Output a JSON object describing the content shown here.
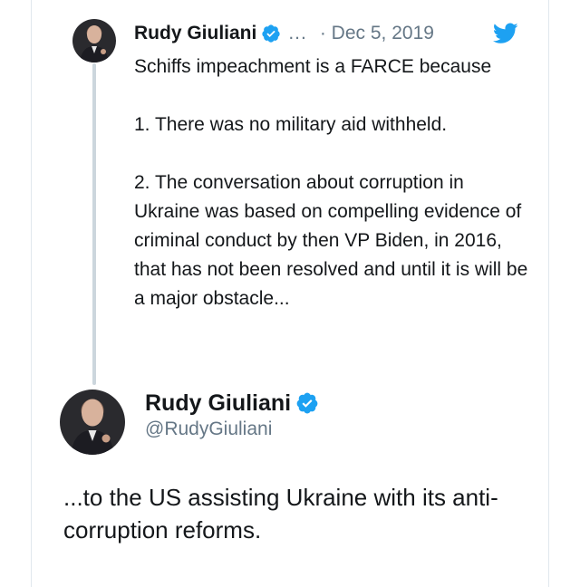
{
  "reply": {
    "author_name": "Rudy Giuliani",
    "more": "...",
    "date": "· Dec 5, 2019",
    "lines": [
      "Schiffs impeachment is a FARCE because",
      "",
      "1. There was no military aid withheld.",
      "",
      "2. The conversation about corruption in Ukraine was based on compelling evidence of criminal conduct by then VP Biden, in 2016, that has not been resolved and until it is will be a major obstacle..."
    ]
  },
  "tweet": {
    "author_name": "Rudy Giuliani",
    "handle": "@RudyGiuliani",
    "text": "...to the US assisting Ukraine with its anti-corruption reforms."
  },
  "icons": {
    "verified": "verified-badge-icon",
    "logo": "twitter-bird-icon"
  },
  "colors": {
    "accent": "#1da1f2",
    "secondary_text": "#657786",
    "primary_text": "#14171a",
    "thread_line": "#ccd6dd"
  }
}
